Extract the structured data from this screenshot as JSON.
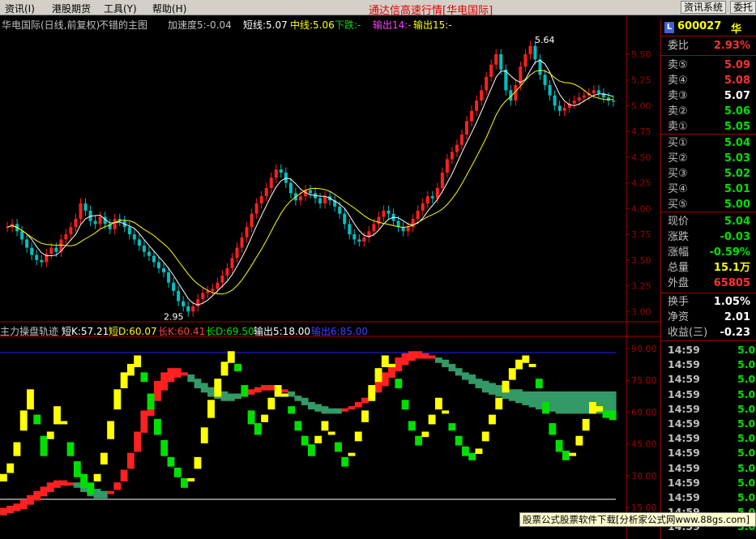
{
  "menu": {
    "items": [
      "资讯(I)",
      "港股期货",
      "工具(Y)",
      "帮助(H)"
    ],
    "app_title": "通达信高速行情[华电国际]",
    "right_buttons": [
      "资讯系统",
      "委托"
    ]
  },
  "main_chart": {
    "header": {
      "stock": "华电国际(日线,前复权)",
      "formula": "不错的主图",
      "accel": "加速度5:-0.04",
      "short_line": "短线:5.07",
      "mid_line": "中线:5.06",
      "down_trend": "下跌:-",
      "out14": "输出14:-",
      "out15": "输出15:-"
    },
    "y_ticks": [
      "5.50",
      "5.25",
      "5.00",
      "4.75",
      "4.50",
      "4.25",
      "4.00",
      "3.75",
      "3.50",
      "3.25",
      "3.00"
    ],
    "high_label": "5.64",
    "low_label": "2.95",
    "ylim": [
      2.9,
      5.72
    ]
  },
  "sub_chart": {
    "header": {
      "name": "主力操盘轨迹",
      "short_k": "短K:57.21",
      "short_d": "短D:60.07",
      "long_k": "长K:60.41",
      "long_d": "长D:69.50",
      "out5": "输出5:18.00",
      "out6": "输出6:85.00"
    },
    "y_ticks": [
      "90.00",
      "75.00",
      "60.00",
      "45.00",
      "30.00",
      "15.00"
    ],
    "ylim": [
      10,
      95
    ]
  },
  "quote_panel": {
    "badge": "L",
    "code": "600027",
    "name_short": "华",
    "wei_bi": {
      "label": "委比",
      "value": "2.93%"
    },
    "sell": [
      {
        "label": "卖⑤",
        "value": "5.09"
      },
      {
        "label": "卖④",
        "value": "5.08"
      },
      {
        "label": "卖③",
        "value": "5.07"
      },
      {
        "label": "卖②",
        "value": "5.06"
      },
      {
        "label": "卖①",
        "value": "5.05"
      }
    ],
    "buy": [
      {
        "label": "买①",
        "value": "5.04"
      },
      {
        "label": "买②",
        "value": "5.03"
      },
      {
        "label": "买③",
        "value": "5.02"
      },
      {
        "label": "买④",
        "value": "5.01"
      },
      {
        "label": "买⑤",
        "value": "5.00"
      }
    ],
    "stats": [
      {
        "label": "现价",
        "value": "5.04"
      },
      {
        "label": "涨跌",
        "value": "-0.03"
      },
      {
        "label": "涨幅",
        "value": "-0.59%"
      },
      {
        "label": "总量",
        "value": "15.1万"
      },
      {
        "label": "外盘",
        "value": "65805"
      }
    ],
    "stats2": [
      {
        "label": "换手",
        "value": "1.05%"
      },
      {
        "label": "净资",
        "value": "2.01"
      },
      {
        "label": "收益(三)",
        "value": "-0.23"
      }
    ],
    "ticks": [
      {
        "time": "14:59",
        "price": "5.0"
      },
      {
        "time": "14:59",
        "price": "5.0"
      },
      {
        "time": "14:59",
        "price": "5.0"
      },
      {
        "time": "14:59",
        "price": "5.0"
      },
      {
        "time": "14:59",
        "price": "5.0"
      },
      {
        "time": "14:59",
        "price": "5.0"
      },
      {
        "time": "14:59",
        "price": "5.0"
      },
      {
        "time": "14:59",
        "price": "5.0"
      },
      {
        "time": "14:59",
        "price": "5.0"
      },
      {
        "time": "14:59",
        "price": "5.0"
      },
      {
        "time": "14:59",
        "price": "5.0"
      },
      {
        "time": "14:59",
        "price": "5.0"
      },
      {
        "time": "14:59",
        "price": "5.0"
      }
    ]
  },
  "footer": {
    "text": "股票公式股票软件下载[分析家公式网www.88gs.com]"
  },
  "colors": {
    "up": "#ff2020",
    "down": "#00c0c0",
    "grid": "#a00000",
    "yellow": "#ffff00",
    "green": "#00e000",
    "dark_green": "#339966",
    "blue": "#4040ff"
  },
  "chart_data": [
    {
      "type": "candlestick",
      "title": "华电国际(日线,前复权)",
      "ylim": [
        2.9,
        5.72
      ],
      "y_ticks": [
        5.5,
        5.25,
        5.0,
        4.75,
        4.5,
        4.25,
        4.0,
        3.75,
        3.5,
        3.25,
        3.0
      ],
      "close": [
        3.82,
        3.85,
        3.78,
        3.7,
        3.62,
        3.55,
        3.5,
        3.48,
        3.56,
        3.62,
        3.58,
        3.7,
        3.75,
        3.82,
        3.9,
        4.05,
        3.98,
        3.88,
        3.85,
        3.92,
        3.85,
        3.8,
        3.9,
        3.88,
        3.82,
        3.75,
        3.7,
        3.64,
        3.58,
        3.54,
        3.48,
        3.42,
        3.38,
        3.28,
        3.2,
        3.1,
        3.05,
        3.0,
        3.05,
        3.12,
        3.18,
        3.2,
        3.22,
        3.28,
        3.35,
        3.42,
        3.52,
        3.62,
        3.72,
        3.82,
        3.95,
        4.05,
        4.12,
        4.2,
        4.3,
        4.38,
        4.35,
        4.25,
        4.15,
        4.08,
        4.12,
        4.18,
        4.15,
        4.1,
        4.05,
        4.12,
        4.08,
        4.02,
        3.95,
        3.85,
        3.75,
        3.7,
        3.68,
        3.72,
        3.78,
        3.85,
        3.92,
        3.98,
        3.95,
        3.88,
        3.82,
        3.78,
        3.82,
        3.9,
        3.98,
        4.05,
        4.12,
        4.1,
        4.2,
        4.35,
        4.48,
        4.55,
        4.62,
        4.72,
        4.85,
        4.95,
        5.05,
        5.15,
        5.28,
        5.4,
        5.5,
        5.35,
        5.15,
        5.05,
        5.2,
        5.38,
        5.5,
        5.58,
        5.45,
        5.3,
        5.2,
        5.1,
        5.0,
        4.95,
        4.98,
        5.02,
        5.05,
        5.08,
        5.1,
        5.12,
        5.15,
        5.12,
        5.08,
        5.05,
        5.04
      ]
    },
    {
      "type": "area",
      "title": "主力操盘轨迹",
      "ylim": [
        10,
        95
      ],
      "y_ticks": [
        90,
        75,
        60,
        45,
        30,
        15
      ],
      "series": [
        {
          "name": "短K",
          "values": [
            30,
            35,
            45,
            60,
            70,
            55,
            40,
            50,
            62,
            55,
            40,
            30,
            25,
            22,
            30,
            40,
            55,
            70,
            78,
            82,
            86,
            75,
            62,
            50,
            40,
            35,
            30,
            25,
            28,
            38,
            52,
            65,
            75,
            83,
            88,
            80,
            68,
            55,
            50,
            58,
            66,
            72,
            68,
            60,
            52,
            45,
            40,
            48,
            55,
            50,
            42,
            35,
            40,
            50,
            60,
            72,
            80,
            86,
            82,
            72,
            62,
            52,
            45,
            50,
            58,
            66,
            60,
            52,
            45,
            40,
            38,
            42,
            50,
            58,
            66,
            74,
            80,
            84,
            86,
            82,
            72,
            60,
            50,
            42,
            38,
            40,
            48,
            56,
            64,
            62,
            58,
            57
          ]
        },
        {
          "name": "短D",
          "values": [
            28,
            32,
            40,
            52,
            62,
            58,
            48,
            48,
            55,
            55,
            45,
            36,
            30,
            26,
            28,
            36,
            48,
            62,
            72,
            78,
            82,
            78,
            68,
            56,
            46,
            38,
            33,
            28,
            28,
            34,
            46,
            58,
            68,
            78,
            84,
            82,
            72,
            60,
            54,
            56,
            62,
            68,
            68,
            62,
            55,
            48,
            44,
            46,
            52,
            50,
            45,
            38,
            40,
            47,
            56,
            66,
            75,
            82,
            82,
            75,
            65,
            55,
            48,
            49,
            55,
            62,
            60,
            54,
            48,
            43,
            40,
            41,
            47,
            55,
            62,
            70,
            76,
            81,
            84,
            82,
            75,
            64,
            54,
            46,
            41,
            40,
            45,
            52,
            60,
            61,
            60,
            60
          ]
        },
        {
          "name": "长K",
          "values": [
            14,
            15,
            16,
            18,
            20,
            22,
            24,
            26,
            27,
            27,
            26,
            25,
            23,
            21,
            20,
            20,
            22,
            26,
            32,
            40,
            50,
            60,
            68,
            74,
            78,
            80,
            80,
            78,
            75,
            72,
            70,
            68,
            67,
            66,
            66,
            67,
            68,
            70,
            71,
            72,
            72,
            71,
            70,
            68,
            66,
            64,
            62,
            61,
            60,
            60,
            60,
            61,
            62,
            64,
            66,
            70,
            74,
            78,
            82,
            85,
            87,
            88,
            88,
            87,
            86,
            84,
            82,
            80,
            78,
            76,
            74,
            72,
            70,
            69,
            68,
            67,
            66,
            65,
            64,
            63,
            62,
            61,
            61,
            60,
            60,
            60,
            60,
            60,
            60,
            60,
            60,
            60
          ]
        },
        {
          "name": "长D",
          "values": [
            12,
            13,
            14,
            15,
            17,
            19,
            21,
            23,
            25,
            26,
            26,
            26,
            25,
            24,
            23,
            22,
            22,
            24,
            28,
            34,
            42,
            51,
            59,
            66,
            71,
            75,
            77,
            78,
            77,
            75,
            73,
            71,
            70,
            69,
            68,
            68,
            68,
            69,
            70,
            71,
            71,
            71,
            70,
            69,
            67,
            66,
            64,
            63,
            62,
            61,
            61,
            61,
            62,
            63,
            65,
            67,
            70,
            73,
            77,
            80,
            83,
            85,
            86,
            86,
            86,
            85,
            84,
            82,
            80,
            78,
            77,
            75,
            74,
            73,
            72,
            71,
            70,
            70,
            69,
            69,
            69,
            69,
            69,
            69,
            69,
            69,
            69,
            69,
            69,
            69,
            69,
            69
          ]
        }
      ]
    }
  ]
}
